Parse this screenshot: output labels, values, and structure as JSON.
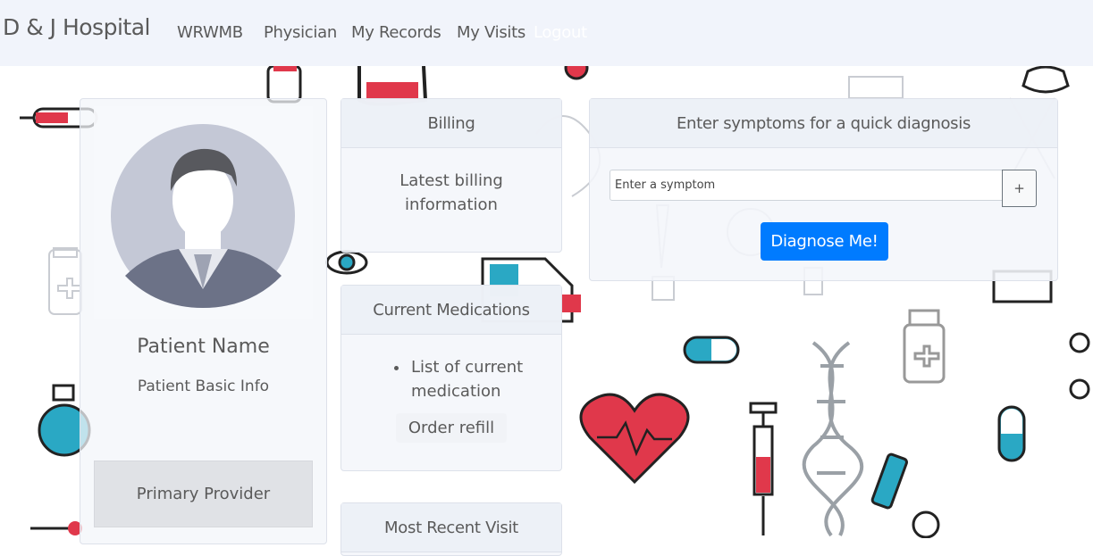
{
  "nav": {
    "brand": "D & J Hospital",
    "links": [
      "WRWMB",
      "Physician",
      "My Records",
      "My Visits",
      "Logout"
    ]
  },
  "profile": {
    "name": "Patient Name",
    "info": "Patient Basic Info",
    "provider": "Primary Provider"
  },
  "billing": {
    "header": "Billing",
    "body": "Latest billing information"
  },
  "meds": {
    "header": "Current Medications",
    "items": [
      "List of current medication"
    ],
    "refill": "Order refill"
  },
  "visit": {
    "header": "Most Recent Visit"
  },
  "symptoms": {
    "header": "Enter symptoms for a quick diagnosis",
    "placeholder": "Enter a symptom",
    "add": "+",
    "diagnose": "Diagnose Me!"
  },
  "colors": {
    "primary": "#007bff",
    "navbar_bg": "#f1f4fb",
    "heart_red": "#e0384b",
    "cyan_accent": "#2aa8c4"
  },
  "icons": [
    "avatar-icon",
    "heart-icon",
    "syringe-icon",
    "dna-icon",
    "pill-capsule-icon",
    "bottle-icon",
    "stethoscope-icon",
    "ambulance-icon",
    "thermometer-icon",
    "eye-icon",
    "flask-icon",
    "iv-bag-icon"
  ]
}
